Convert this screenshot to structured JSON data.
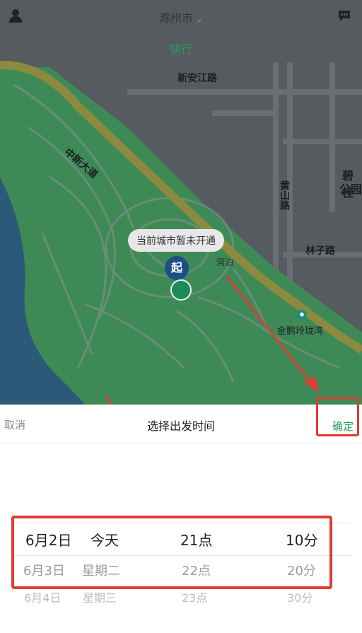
{
  "header": {
    "city": "滁州市",
    "tab": "快行"
  },
  "map": {
    "roads": [
      "新安江路",
      "中新大道",
      "黄山路",
      "林子路"
    ],
    "place_partial": "碧桂",
    "place_partial2": "公园",
    "river_label": "河泊",
    "poi_label": "金鹏玲珑湾",
    "toast": "当前城市暂未开通",
    "pin_label": "起"
  },
  "sheet": {
    "cancel": "取消",
    "title": "选择出发时间",
    "confirm": "确定"
  },
  "picker": {
    "rows": [
      {
        "date": "6月2日",
        "weekday": "今天",
        "hour": "21点",
        "minute": "10分"
      },
      {
        "date": "6月3日",
        "weekday": "星期二",
        "hour": "22点",
        "minute": "20分"
      },
      {
        "date": "6月4日",
        "weekday": "星期三",
        "hour": "23点",
        "minute": "30分"
      }
    ]
  },
  "colors": {
    "accent": "#1f9f5d",
    "annotation": "#e23a34",
    "park": "#3e8a57",
    "water": "#2a5a78"
  }
}
